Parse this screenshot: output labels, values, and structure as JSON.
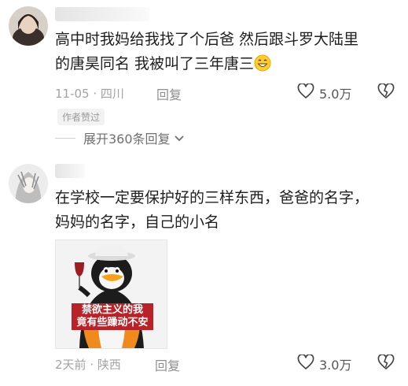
{
  "comments": [
    {
      "text_line1": "高中时我妈给我找了个后爸 然后跟斗罗大陆里",
      "text_line2": "的唐昊同名 我被叫了三年唐三",
      "date": "11-05",
      "location": "四川",
      "reply_label": "回复",
      "likes": "5.0万",
      "badge": "作者赞过",
      "expand_label": "展开360条回复"
    },
    {
      "text_line1": "在学校一定要保护好的三样东西，爸爸的名字，",
      "text_line2": "妈妈的名字，自己的小名",
      "sticker": {
        "caption_line1": "禁欲主义的我",
        "caption_line2": "竟有些躁动不安"
      },
      "date": "2天前",
      "location": "陕西",
      "reply_label": "回复",
      "likes": "3.0万"
    }
  ],
  "icons": {
    "like": "heart-outline-icon",
    "dislike": "broken-heart-icon",
    "expand": "chevron-down-icon",
    "emoji": "grinning-face-emoji"
  },
  "colors": {
    "text": "#1e1e1e",
    "meta": "#a3a3a3",
    "caption_bg": "#b8232a"
  }
}
